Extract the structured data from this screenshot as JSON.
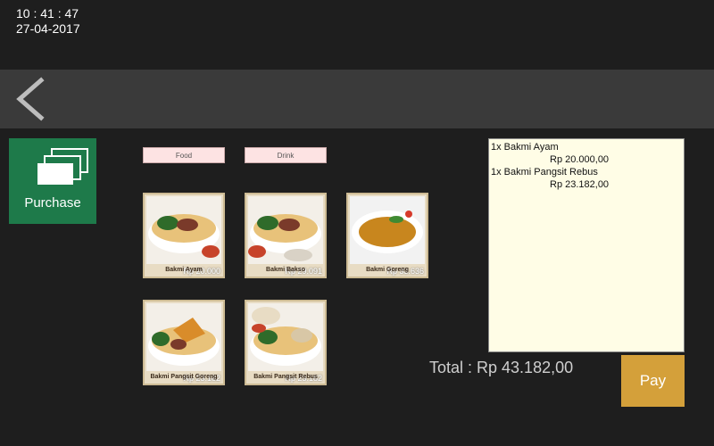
{
  "clock": {
    "time": "10 : 41 : 47",
    "date": "27-04-2017"
  },
  "nav": {
    "back_icon": "chevron-left-icon"
  },
  "purchase_tile": {
    "label": "Purchase",
    "icon": "cards-icon",
    "color": "#1e7a4a"
  },
  "categories": [
    {
      "label": "Food"
    },
    {
      "label": "Drink"
    }
  ],
  "products": [
    {
      "name": "Bakmi Ayam",
      "price": "Rp 20.000"
    },
    {
      "name": "Bakmi Bakso",
      "price": "Rp 29.091"
    },
    {
      "name": "Bakmi Goreng",
      "price": "Rp 33.636"
    },
    {
      "name": "Bakmi Pangsit Goreng",
      "price": "Rp 23.182"
    },
    {
      "name": "Bakmi Pangsit Rebus",
      "price": "Rp 23.182"
    }
  ],
  "receipt": {
    "items": [
      {
        "line": "1x Bakmi Ayam",
        "price": "Rp 20.000,00"
      },
      {
        "line": "1x Bakmi Pangsit Rebus",
        "price": "Rp 23.182,00"
      }
    ]
  },
  "total": {
    "text": "Total : Rp 43.182,00"
  },
  "pay_button": {
    "label": "Pay",
    "color": "#d4a03a"
  }
}
